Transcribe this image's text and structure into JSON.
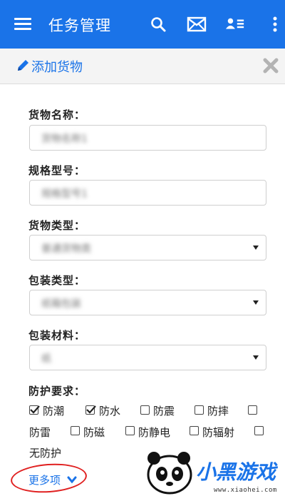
{
  "appbar": {
    "title": "任务管理",
    "icons": [
      "menu-icon",
      "search-icon",
      "mail-icon",
      "contacts-icon",
      "more-vert-icon"
    ],
    "color": "#1a73e8"
  },
  "subheader": {
    "title": "添加货物"
  },
  "form": {
    "name_label": "货物名称：",
    "name_value": "货物名称1",
    "spec_label": "规格型号：",
    "spec_value": "规格型号1",
    "cargo_type_label": "货物类型：",
    "cargo_type_value": "普通货物类",
    "pack_type_label": "包装类型：",
    "pack_type_value": "纸箱包装",
    "pack_material_label": "包装材料：",
    "pack_material_value": "纸",
    "protect_label": "防护要求：",
    "options": [
      {
        "label": "防潮",
        "checked": true
      },
      {
        "label": "防水",
        "checked": true
      },
      {
        "label": "防震",
        "checked": false
      },
      {
        "label": "防摔",
        "checked": false
      },
      {
        "label": "防雷",
        "checked": false
      },
      {
        "label": "防磁",
        "checked": false
      },
      {
        "label": "防静电",
        "checked": false
      },
      {
        "label": "防辐射",
        "checked": false
      },
      {
        "label": "无防护",
        "checked": false
      }
    ],
    "more_label": "更多项"
  },
  "watermark": {
    "text": "小黑游戏",
    "url": "www.xiaohei.com"
  }
}
